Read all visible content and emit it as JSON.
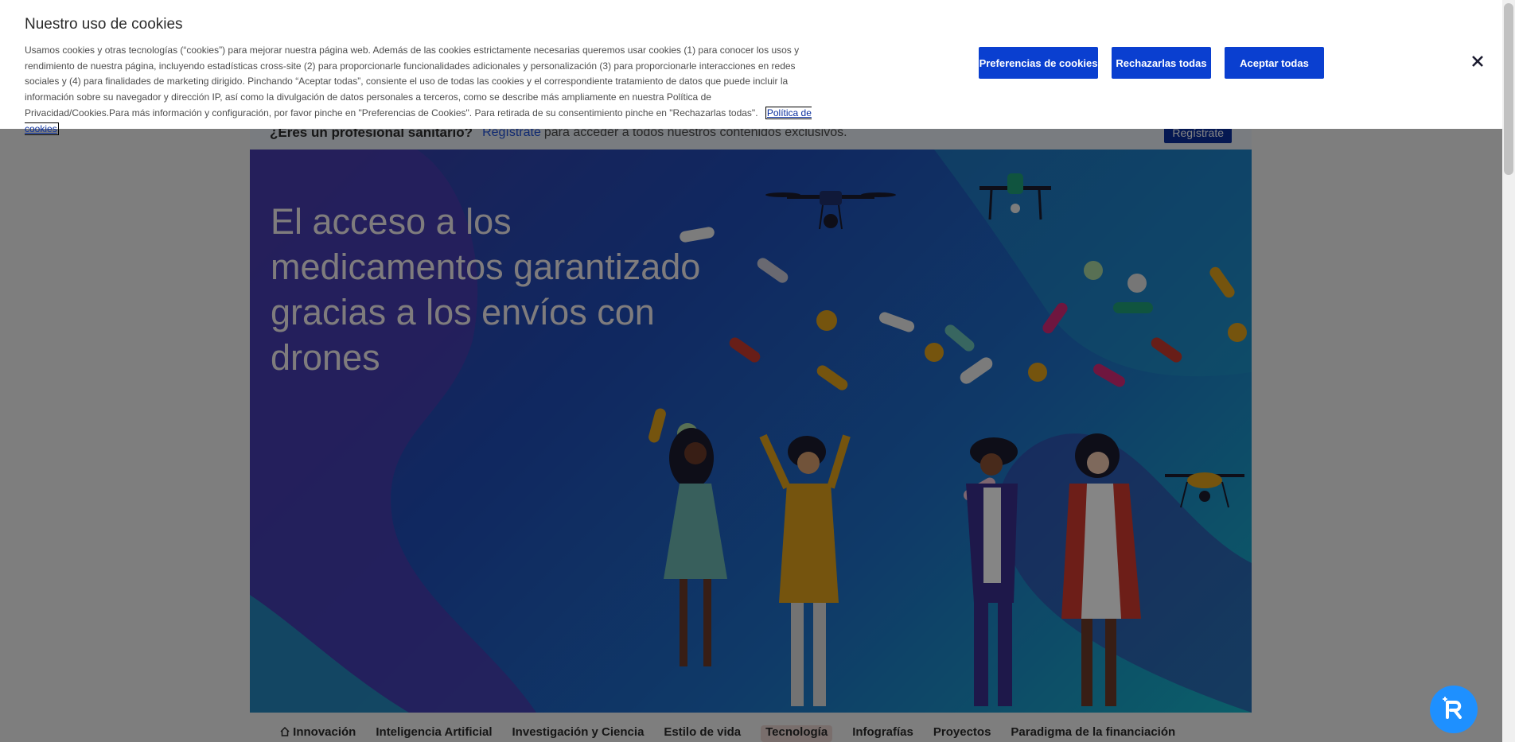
{
  "promo": {
    "question": "¿Eres un profesional sanitario?",
    "register_link": "Regístrate",
    "rest": "para acceder a todos nuestros contenidos exclusivos.",
    "register_button": "Regístrate"
  },
  "hero": {
    "title": "El acceso a los medicamentos garantizado gracias a los envíos con drones"
  },
  "filter_bar": {
    "items": [
      "Innovación",
      "Inteligencia Artificial",
      "Investigación y Ciencia",
      "Estilo de vida",
      "Tecnología",
      "Infografías",
      "Proyectos",
      "Paradigma de la financiación"
    ],
    "active": "Tecnología"
  },
  "cookie_banner": {
    "title": "Nuestro uso de cookies",
    "text": "Usamos cookies y otras tecnologías (“cookies”) para mejorar nuestra página web. Además de las cookies estrictamente necesarias queremos usar cookies (1) para conocer los usos y rendimiento de nuestra página, incluyendo estadísticas cross-site (2) para proporcionarle funcionalidades adicionales y personalización (3) para proporcionarle interacciones en redes sociales y (4) para finalidades de marketing dirigido. Pinchando “Aceptar todas”, consiente el uso de todas las cookies y el correspondiente tratamiento de datos que puede incluir la información sobre su navegador y dirección IP, así como la divulgación de datos personales a terceros, como se describe más ampliamente en nuestra Política de Privacidad/Cookies.Para más información y configuración, por favor pinche en \"Preferencias de Cookies\". Para retirada de su consentimiento pinche en \"Rechazarlas todas\".",
    "policy_link": "Política de cookies",
    "buttons": {
      "preferences": "Preferencias de cookies",
      "reject": "Rechazarlas todas",
      "accept": "Aceptar todas"
    }
  },
  "icons": {
    "close": "close-icon",
    "home": "home-icon",
    "assistant": "assistant-icon"
  },
  "colors": {
    "primary_button": "#0a3fd0",
    "fab": "#1e90ff"
  }
}
